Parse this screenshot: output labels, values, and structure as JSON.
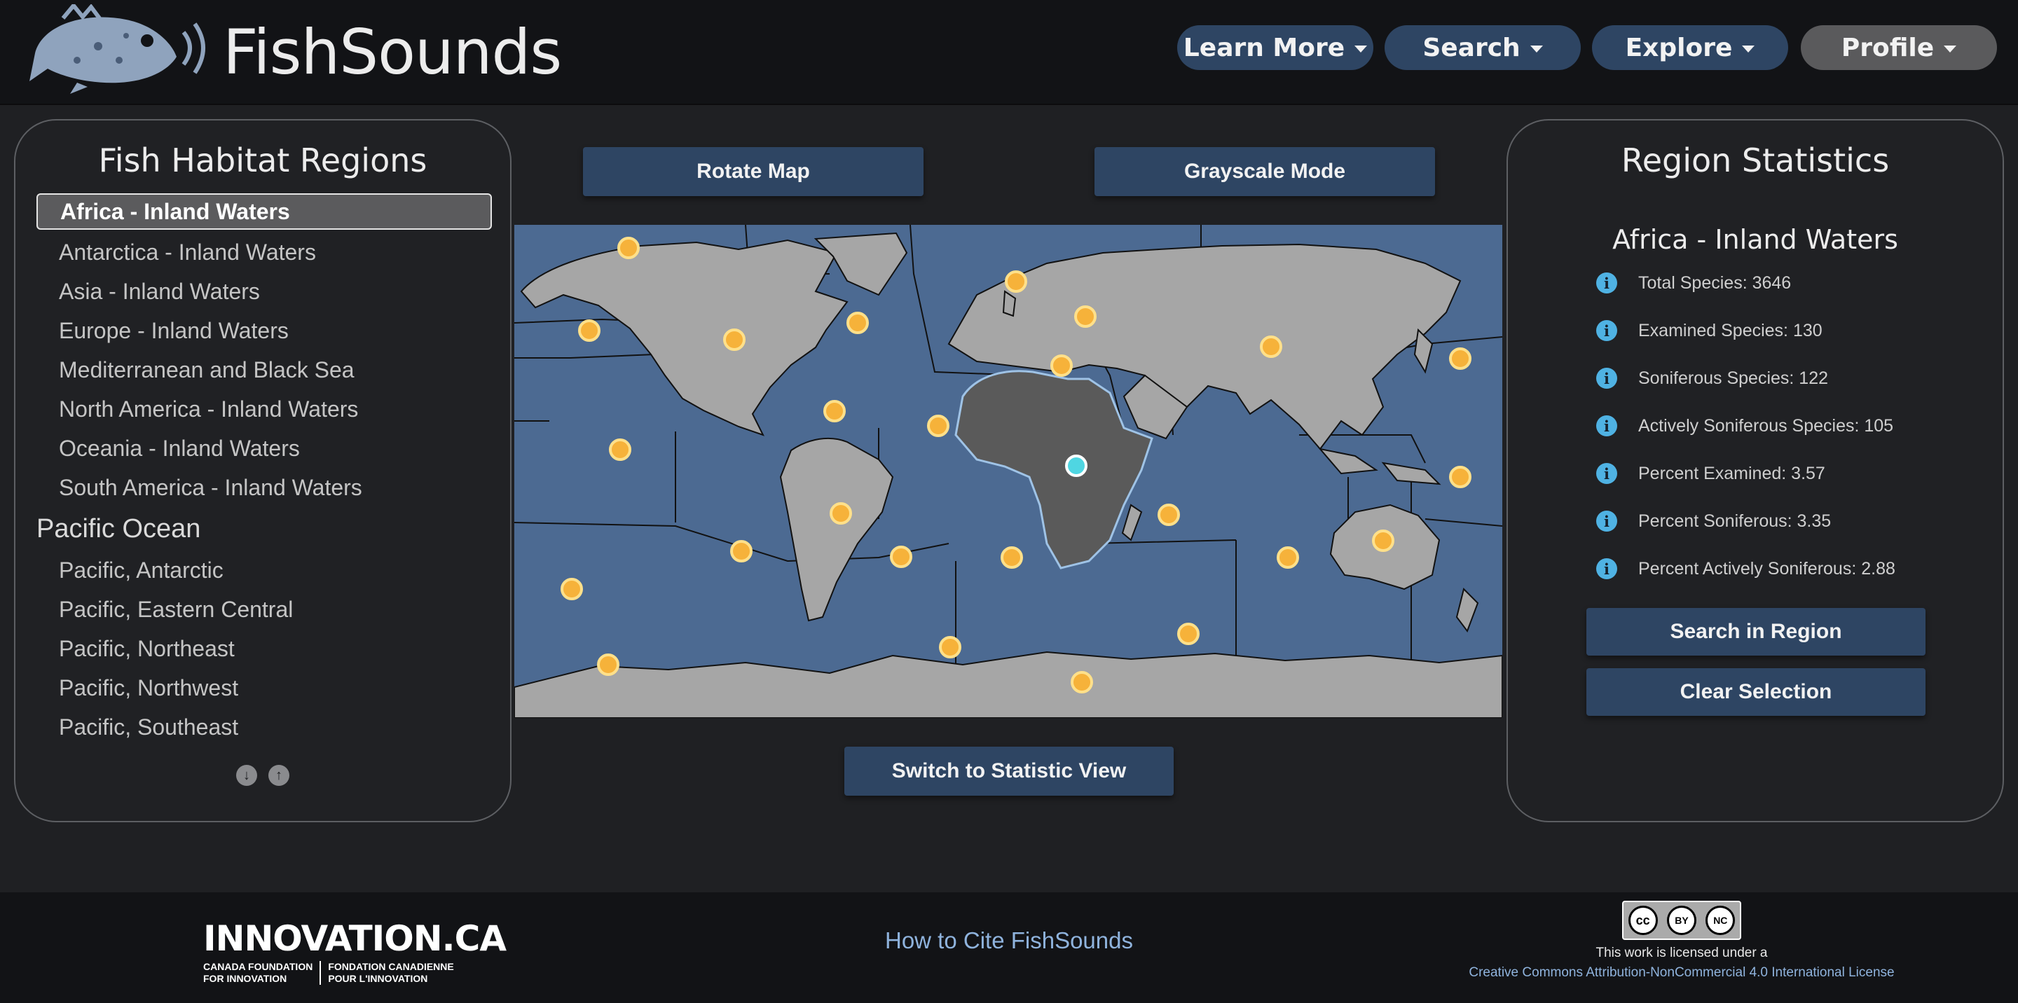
{
  "header": {
    "brand": "FishSounds",
    "nav": [
      {
        "label": "Learn More"
      },
      {
        "label": "Search"
      },
      {
        "label": "Explore"
      },
      {
        "label": "Profile"
      }
    ]
  },
  "left_panel": {
    "title": "Fish Habitat Regions",
    "items": [
      {
        "label": "Africa - Inland Waters",
        "selected": true
      },
      {
        "label": "Antarctica - Inland Waters"
      },
      {
        "label": "Asia - Inland Waters"
      },
      {
        "label": "Europe - Inland Waters"
      },
      {
        "label": "Mediterranean and Black Sea"
      },
      {
        "label": "North America - Inland Waters"
      },
      {
        "label": "Oceania - Inland Waters"
      },
      {
        "label": "South America - Inland Waters"
      }
    ],
    "group": "Pacific Ocean",
    "group_items": [
      {
        "label": "Pacific, Antarctic"
      },
      {
        "label": "Pacific, Eastern Central"
      },
      {
        "label": "Pacific, Northeast"
      },
      {
        "label": "Pacific, Northwest"
      },
      {
        "label": "Pacific, Southeast"
      }
    ]
  },
  "map": {
    "rotate_label": "Rotate Map",
    "grayscale_label": "Grayscale Mode",
    "switch_label": "Switch to Statistic View",
    "ocean_color": "#4c6a92",
    "land_color": "#a6a6a6",
    "selected_color": "#5a5a5a",
    "marker_color": "#f6b23a",
    "selected_marker_color": "#4fd6e2"
  },
  "right_panel": {
    "title": "Region Statistics",
    "region": "Africa - Inland Waters",
    "stats": [
      {
        "label": "Total Species: 3646"
      },
      {
        "label": "Examined Species: 130"
      },
      {
        "label": "Soniferous Species: 122"
      },
      {
        "label": "Actively Soniferous Species: 105"
      },
      {
        "label": "Percent Examined: 3.57"
      },
      {
        "label": "Percent Soniferous: 3.35"
      },
      {
        "label": "Percent Actively Soniferous: 2.88"
      }
    ],
    "search_label": "Search in Region",
    "clear_label": "Clear Selection"
  },
  "footer": {
    "innovation": {
      "main": "INNOVATION.CA",
      "sub_left_1": "CANADA FOUNDATION",
      "sub_left_2": "FOR INNOVATION",
      "sub_right_1": "FONDATION CANADIENNE",
      "sub_right_2": "POUR L'INNOVATION"
    },
    "cite_link": "How to Cite FishSounds",
    "license_text": "This work is licensed under a",
    "license_link": "Creative Commons Attribution-NonCommercial 4.0 International License",
    "cc_badge": {
      "cc": "cc",
      "by": "BY",
      "nc": "NC"
    }
  }
}
